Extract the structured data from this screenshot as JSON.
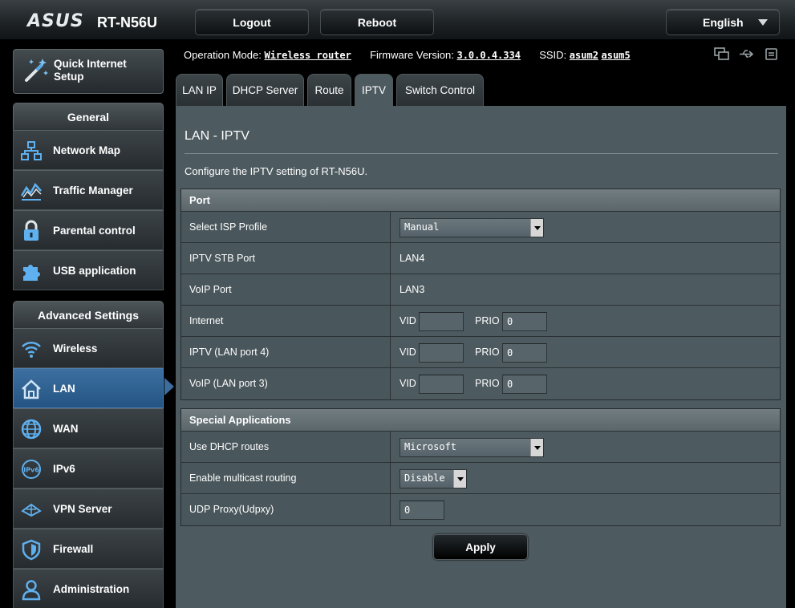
{
  "header": {
    "brand": "ASUS",
    "model": "RT-N56U",
    "logout_label": "Logout",
    "reboot_label": "Reboot",
    "language_label": "English"
  },
  "sidebar": {
    "quick_setup_label": "Quick Internet Setup",
    "general_heading": "General",
    "general_items": [
      {
        "label": "Network Map",
        "icon": "network-map-icon"
      },
      {
        "label": "Traffic Manager",
        "icon": "traffic-manager-icon"
      },
      {
        "label": "Parental control",
        "icon": "lock-icon"
      },
      {
        "label": "USB application",
        "icon": "puzzle-icon"
      }
    ],
    "advanced_heading": "Advanced Settings",
    "advanced_items": [
      {
        "label": "Wireless",
        "icon": "wifi-icon"
      },
      {
        "label": "LAN",
        "icon": "home-icon",
        "active": true
      },
      {
        "label": "WAN",
        "icon": "globe-icon"
      },
      {
        "label": "IPv6",
        "icon": "ipv6-icon"
      },
      {
        "label": "VPN Server",
        "icon": "vpn-icon"
      },
      {
        "label": "Firewall",
        "icon": "shield-icon"
      },
      {
        "label": "Administration",
        "icon": "user-icon"
      }
    ]
  },
  "status": {
    "mode_label": "Operation Mode:",
    "mode_value": "Wireless router",
    "fw_label": "Firmware Version:",
    "fw_value": "3.0.0.4.334",
    "ssid_label": "SSID:",
    "ssid_1": "asum2",
    "ssid_2": "asum5"
  },
  "tabs": [
    {
      "label": "LAN IP"
    },
    {
      "label": "DHCP Server"
    },
    {
      "label": "Route"
    },
    {
      "label": "IPTV",
      "selected": true
    },
    {
      "label": "Switch Control"
    }
  ],
  "main": {
    "title": "LAN - IPTV",
    "description": "Configure the IPTV setting of RT-N56U.",
    "port_section": {
      "heading": "Port",
      "isp_profile_label": "Select ISP Profile",
      "isp_profile_value": "Manual",
      "stb_port_label": "IPTV STB Port",
      "stb_port_value": "LAN4",
      "voip_port_label": "VoIP Port",
      "voip_port_value": "LAN3",
      "vid_label": "VID",
      "prio_label": "PRIO",
      "internet_label": "Internet",
      "internet_vid": "",
      "internet_prio": "0",
      "iptv_label": "IPTV (LAN port 4)",
      "iptv_vid": "",
      "iptv_prio": "0",
      "voip_label": "VoIP (LAN port 3)",
      "voip_vid": "",
      "voip_prio": "0"
    },
    "special_section": {
      "heading": "Special Applications",
      "dhcp_routes_label": "Use DHCP routes",
      "dhcp_routes_value": "Microsoft",
      "multicast_label": "Enable multicast routing",
      "multicast_value": "Disable",
      "udpxy_label": "UDP Proxy(Udpxy)",
      "udpxy_value": "0"
    },
    "apply_label": "Apply"
  },
  "colors": {
    "active_menu": "#2f5f8f",
    "panel": "#4d5a5f"
  }
}
